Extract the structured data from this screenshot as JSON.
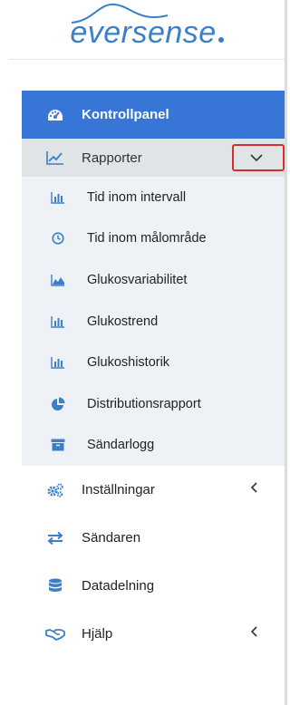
{
  "brand": {
    "logo_text": "eversense"
  },
  "colors": {
    "accent": "#3775d6",
    "icon": "#3a7fc8",
    "highlight_border": "#d32f2f"
  },
  "menu": {
    "dashboard": {
      "label": "Kontrollpanel",
      "icon": "dashboard-gauge-icon"
    },
    "reports": {
      "label": "Rapporter",
      "icon": "line-chart-icon",
      "expanded": true,
      "children": [
        {
          "label": "Tid inom intervall",
          "icon": "bar-chart-icon"
        },
        {
          "label": "Tid inom målområde",
          "icon": "clock-icon"
        },
        {
          "label": "Glukosvariabilitet",
          "icon": "area-chart-icon"
        },
        {
          "label": "Glukostrend",
          "icon": "bar-chart-icon"
        },
        {
          "label": "Glukoshistorik",
          "icon": "bar-chart-icon"
        },
        {
          "label": "Distributionsrapport",
          "icon": "pie-chart-icon"
        },
        {
          "label": "Sändarlogg",
          "icon": "archive-box-icon"
        }
      ]
    },
    "settings": {
      "label": "Inställningar",
      "icon": "gears-icon"
    },
    "transmitter": {
      "label": "Sändaren",
      "icon": "exchange-arrows-icon"
    },
    "data_sharing": {
      "label": "Datadelning",
      "icon": "database-icon"
    },
    "help": {
      "label": "Hjälp",
      "icon": "handshake-icon"
    }
  }
}
